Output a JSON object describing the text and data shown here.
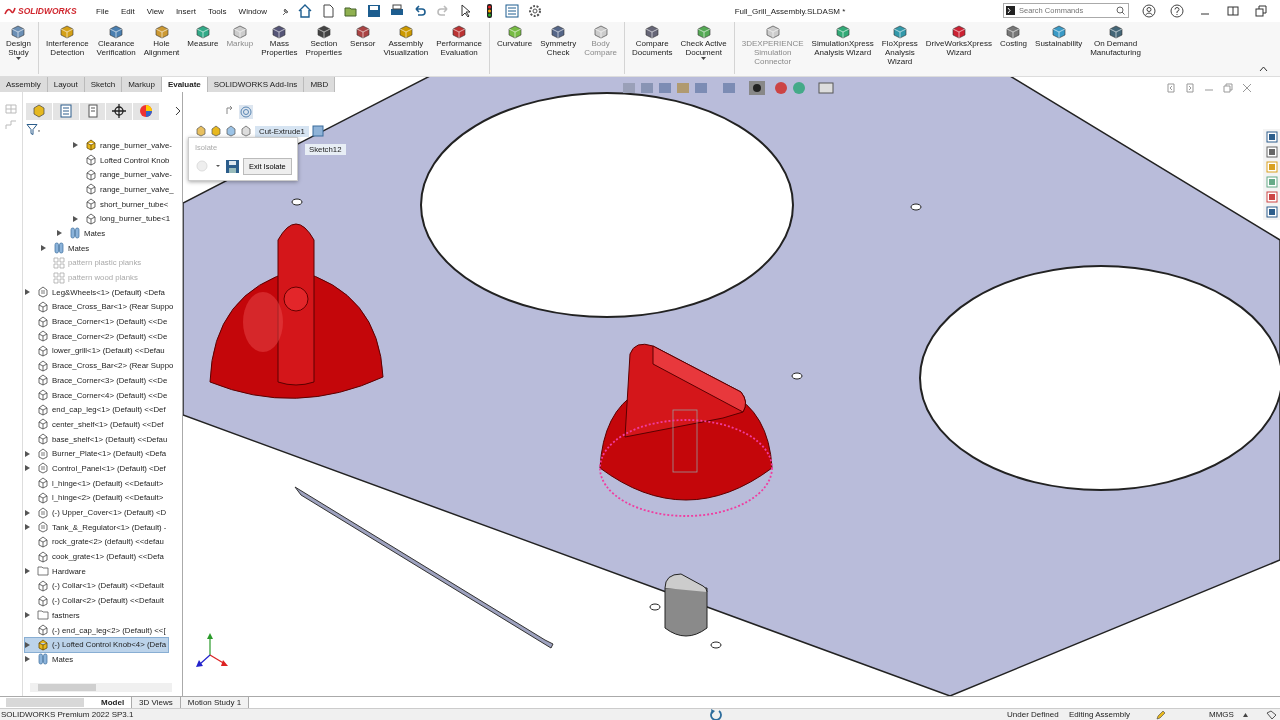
{
  "app": {
    "brand": "SOLIDWORKS",
    "menu": [
      "File",
      "Edit",
      "View",
      "Insert",
      "Tools",
      "Window"
    ],
    "document_title": "Full_Grill_Assembly.SLDASM *",
    "search": {
      "placeholder": "Search Commands"
    }
  },
  "ribbon": {
    "commands": [
      {
        "label": "Design\nStudy",
        "disabled": false,
        "group_start": false,
        "dropdown": true
      },
      {
        "label": "Interference\nDetection",
        "disabled": false,
        "group_start": true,
        "dropdown": false
      },
      {
        "label": "Clearance\nVerification",
        "disabled": false,
        "group_start": false,
        "dropdown": false
      },
      {
        "label": "Hole\nAlignment",
        "disabled": false,
        "group_start": false,
        "dropdown": false
      },
      {
        "label": "Measure",
        "disabled": false,
        "group_start": false,
        "dropdown": false
      },
      {
        "label": "Markup",
        "disabled": true,
        "group_start": false,
        "dropdown": false
      },
      {
        "label": "Mass\nProperties",
        "disabled": false,
        "group_start": false,
        "dropdown": false
      },
      {
        "label": "Section\nProperties",
        "disabled": false,
        "group_start": false,
        "dropdown": false
      },
      {
        "label": "Sensor",
        "disabled": false,
        "group_start": false,
        "dropdown": false
      },
      {
        "label": "Assembly\nVisualization",
        "disabled": false,
        "group_start": false,
        "dropdown": false
      },
      {
        "label": "Performance\nEvaluation",
        "disabled": false,
        "group_start": false,
        "dropdown": false
      },
      {
        "label": "Curvature",
        "disabled": false,
        "group_start": true,
        "dropdown": false
      },
      {
        "label": "Symmetry\nCheck",
        "disabled": false,
        "group_start": false,
        "dropdown": false
      },
      {
        "label": "Body\nCompare",
        "disabled": true,
        "group_start": false,
        "dropdown": false
      },
      {
        "label": "Compare\nDocuments",
        "disabled": false,
        "group_start": true,
        "dropdown": false
      },
      {
        "label": "Check Active\nDocument",
        "disabled": false,
        "group_start": false,
        "dropdown": true
      },
      {
        "label": "3DEXPERIENCE\nSimulation\nConnector",
        "disabled": true,
        "group_start": true,
        "dropdown": false
      },
      {
        "label": "SimulationXpress\nAnalysis Wizard",
        "disabled": false,
        "group_start": false,
        "dropdown": false
      },
      {
        "label": "FloXpress\nAnalysis\nWizard",
        "disabled": false,
        "group_start": false,
        "dropdown": false
      },
      {
        "label": "DriveWorksXpress\nWizard",
        "disabled": false,
        "group_start": false,
        "dropdown": false
      },
      {
        "label": "Costing",
        "disabled": false,
        "group_start": false,
        "dropdown": false
      },
      {
        "label": "Sustainability",
        "disabled": false,
        "group_start": false,
        "dropdown": false
      },
      {
        "label": "On Demand\nManufacturing",
        "disabled": false,
        "group_start": false,
        "dropdown": false
      }
    ]
  },
  "tabs": [
    {
      "label": "Assembly",
      "selected": false
    },
    {
      "label": "Layout",
      "selected": false
    },
    {
      "label": "Sketch",
      "selected": false
    },
    {
      "label": "Markup",
      "selected": false
    },
    {
      "label": "Evaluate",
      "selected": true
    },
    {
      "label": "SOLIDWORKS Add-Ins",
      "selected": false
    },
    {
      "label": "MBD",
      "selected": false
    }
  ],
  "feature_tree": {
    "items": [
      {
        "children": [
          {
            "children": [
              {
                "children": [
                  {
                    "label": "range_burner_valve-",
                    "kind": "active-part",
                    "expandable": true,
                    "suppressed": false,
                    "selected": false
                  },
                  {
                    "label": "Lofted Control Knob",
                    "kind": "part",
                    "expandable": false,
                    "suppressed": false,
                    "selected": false
                  },
                  {
                    "label": "range_burner_valve-",
                    "kind": "part",
                    "expandable": false,
                    "suppressed": false,
                    "selected": false
                  },
                  {
                    "label": "range_burner_valve_",
                    "kind": "part",
                    "expandable": false,
                    "suppressed": false,
                    "selected": false
                  },
                  {
                    "label": "short_burner_tube<",
                    "kind": "part",
                    "expandable": false,
                    "suppressed": false,
                    "selected": false
                  },
                  {
                    "label": "long_burner_tube<1",
                    "kind": "part",
                    "expandable": true,
                    "suppressed": false,
                    "selected": false
                  }
                ]
              },
              {
                "label": "Mates",
                "kind": "mates",
                "expandable": true,
                "suppressed": false,
                "selected": false
              }
            ]
          },
          {
            "label": "Mates",
            "kind": "mates",
            "expandable": true,
            "suppressed": false,
            "selected": false
          },
          {
            "label": "pattern plastic planks",
            "kind": "pattern",
            "expandable": false,
            "suppressed": true,
            "selected": false
          },
          {
            "label": "pattern wood planks",
            "kind": "pattern",
            "expandable": false,
            "suppressed": true,
            "selected": false
          }
        ]
      },
      {
        "label": "Leg&Wheels<1> (Default) <Defa",
        "kind": "assembly",
        "expandable": true,
        "suppressed": false,
        "selected": false
      },
      {
        "label": "Brace_Cross_Bar<1> (Rear Suppo",
        "kind": "part",
        "expandable": false,
        "suppressed": false,
        "selected": false
      },
      {
        "label": "Brace_Corner<1> (Default) <<De",
        "kind": "part",
        "expandable": false,
        "suppressed": false,
        "selected": false
      },
      {
        "label": "Brace_Corner<2> (Default) <<De",
        "kind": "part",
        "expandable": false,
        "suppressed": false,
        "selected": false
      },
      {
        "label": "lower_grill<1> (Default) <<Defau",
        "kind": "part",
        "expandable": false,
        "suppressed": false,
        "selected": false
      },
      {
        "label": "Brace_Cross_Bar<2> (Rear Suppo",
        "kind": "part",
        "expandable": false,
        "suppressed": false,
        "selected": false
      },
      {
        "label": "Brace_Corner<3> (Default) <<De",
        "kind": "part",
        "expandable": false,
        "suppressed": false,
        "selected": false
      },
      {
        "label": "Brace_Corner<4> (Default) <<De",
        "kind": "part",
        "expandable": false,
        "suppressed": false,
        "selected": false
      },
      {
        "label": "end_cap_leg<1> (Default) <<Def",
        "kind": "part",
        "expandable": false,
        "suppressed": false,
        "selected": false
      },
      {
        "label": "center_shelf<1> (Default) <<Def",
        "kind": "part",
        "expandable": false,
        "suppressed": false,
        "selected": false
      },
      {
        "label": "base_shelf<1> (Default) <<Defau",
        "kind": "part",
        "expandable": false,
        "suppressed": false,
        "selected": false
      },
      {
        "label": "Burner_Plate<1> (Default) <Defa",
        "kind": "assembly",
        "expandable": true,
        "suppressed": false,
        "selected": false
      },
      {
        "label": "Control_Panel<1> (Default) <Def",
        "kind": "assembly",
        "expandable": true,
        "suppressed": false,
        "selected": false
      },
      {
        "label": "l_hinge<1> (Default) <<Default>",
        "kind": "part",
        "expandable": false,
        "suppressed": false,
        "selected": false
      },
      {
        "label": "l_hinge<2> (Default) <<Default>",
        "kind": "part",
        "expandable": false,
        "suppressed": false,
        "selected": false
      },
      {
        "label": "(-) Upper_Cover<1> (Default) <D",
        "kind": "assembly",
        "expandable": true,
        "suppressed": false,
        "selected": false
      },
      {
        "label": "Tank_&_Regulator<1> (Default) -",
        "kind": "assembly",
        "expandable": true,
        "suppressed": false,
        "selected": false
      },
      {
        "label": "rock_grate<2> (default) <<defau",
        "kind": "part",
        "expandable": false,
        "suppressed": false,
        "selected": false
      },
      {
        "label": "cook_grate<1> (Default) <<Defa",
        "kind": "part",
        "expandable": false,
        "suppressed": false,
        "selected": false
      },
      {
        "label": "Hardware",
        "kind": "folder",
        "expandable": true,
        "suppressed": false,
        "selected": false
      },
      {
        "label": "(-) Collar<1> (Default) <<Default",
        "kind": "part",
        "expandable": false,
        "suppressed": false,
        "selected": false
      },
      {
        "label": "(-) Collar<2> (Default) <<Default",
        "kind": "part",
        "expandable": false,
        "suppressed": false,
        "selected": false
      },
      {
        "label": "fastners",
        "kind": "folder",
        "expandable": true,
        "suppressed": false,
        "selected": false
      },
      {
        "label": "(-) end_cap_leg<2> (Default) <<[",
        "kind": "part",
        "expandable": false,
        "suppressed": false,
        "selected": false
      },
      {
        "label": "(-) Lofted Control Knob<4> (Defa",
        "kind": "active-part",
        "expandable": true,
        "suppressed": false,
        "selected": true
      },
      {
        "label": "Mates",
        "kind": "mates",
        "expandable": true,
        "suppressed": false,
        "selected": false
      }
    ]
  },
  "viewport": {
    "breadcrumb": {
      "feature": "Cut-Extrude1",
      "sketch": "Sketch12"
    },
    "isolate_popup": {
      "title": "Isolate",
      "button": "Exit Isolate"
    }
  },
  "bottom_tabs": [
    {
      "label": "Model",
      "selected": true
    },
    {
      "label": "3D Views",
      "selected": false
    },
    {
      "label": "Motion Study 1",
      "selected": false
    }
  ],
  "status_bar": {
    "product": "SOLIDWORKS Premium 2022 SP3.1",
    "state": "Under Defined",
    "mode": "Editing Assembly",
    "units": "MMGS"
  }
}
